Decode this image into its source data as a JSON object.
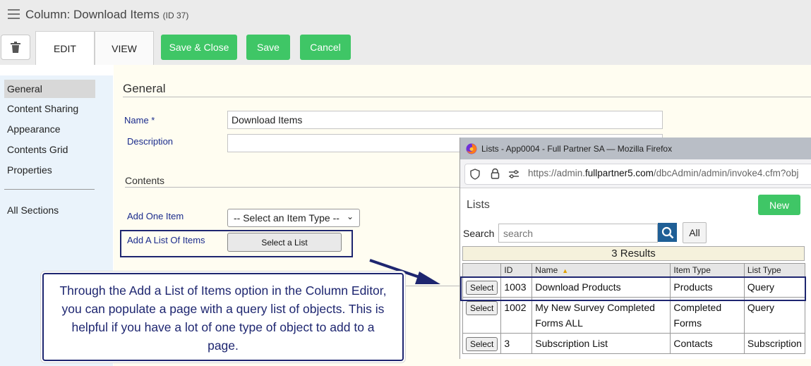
{
  "header": {
    "title": "Column: Download Items",
    "id_label": "(ID 37)",
    "tabs": [
      {
        "label": "EDIT"
      },
      {
        "label": "VIEW"
      }
    ],
    "buttons": {
      "save_close": "Save & Close",
      "save": "Save",
      "cancel": "Cancel"
    }
  },
  "sidebar": {
    "items": [
      {
        "label": "General",
        "active": true
      },
      {
        "label": "Content Sharing"
      },
      {
        "label": "Appearance"
      },
      {
        "label": "Contents Grid"
      },
      {
        "label": "Properties"
      },
      {
        "label": "All Sections"
      }
    ]
  },
  "form": {
    "general_title": "General",
    "name_label": "Name *",
    "name_value": "Download Items",
    "description_label": "Description",
    "description_value": "",
    "contents_title": "Contents",
    "add_one_label": "Add One Item",
    "item_type_selected": "-- Select an Item Type --",
    "add_list_label": "Add A List Of Items",
    "select_list_button": "Select a List"
  },
  "callout": {
    "text": "Through the Add a List of Items option in the Column Editor, you can populate a page with a query list of objects. This is helpful if you have a lot of one type of object to add to a page."
  },
  "popup": {
    "window_title": "Lists - App0004 - Full Partner SA — Mozilla Firefox",
    "url_prefix": "https://admin.",
    "url_domain": "fullpartner5.com",
    "url_suffix": "/dbcAdmin/admin/invoke4.cfm?obj",
    "heading": "Lists",
    "new_button": "New",
    "search_label": "Search",
    "search_placeholder": "search",
    "all_button": "All",
    "results_text": "3 Results",
    "columns": [
      "ID",
      "Name",
      "Item Type",
      "List Type"
    ],
    "rows": [
      {
        "action": "Select",
        "id": "1003",
        "name": "Download Products",
        "item_type": "Products",
        "list_type": "Query"
      },
      {
        "action": "Select",
        "id": "1002",
        "name": "My New Survey Completed Forms ALL",
        "item_type": "Completed Forms",
        "list_type": "Query"
      },
      {
        "action": "Select",
        "id": "3",
        "name": "Subscription List",
        "item_type": "Contacts",
        "list_type": "Subscription"
      }
    ]
  },
  "colors": {
    "green": "#3fc666",
    "navy": "#1e2670",
    "label_blue": "#1a2b8c",
    "panel_bg": "#fffdf1",
    "sidebar_bg": "#eaf3fb"
  },
  "icons": [
    "hamburger-icon",
    "trash-icon",
    "firefox-icon",
    "shield-icon",
    "lock-icon",
    "permissions-icon",
    "search-icon",
    "sort-icon"
  ]
}
